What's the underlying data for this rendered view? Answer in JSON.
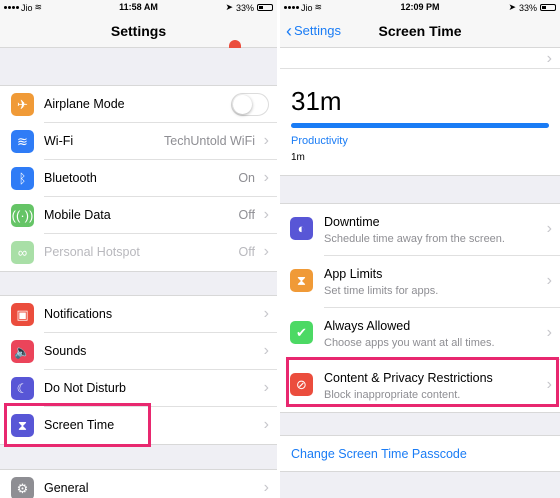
{
  "left": {
    "status": {
      "carrier": "Jio",
      "time": "11:58 AM",
      "battery": "33%"
    },
    "nav_title": "Settings",
    "group1": [
      {
        "label": "Airplane Mode",
        "icon": "airplane-icon",
        "color": "#f09a37",
        "toggle": false
      },
      {
        "label": "Wi-Fi",
        "value": "TechUntold WiFi",
        "icon": "wifi-icon",
        "color": "#2f7cf6"
      },
      {
        "label": "Bluetooth",
        "value": "On",
        "icon": "bluetooth-icon",
        "color": "#2f7cf6"
      },
      {
        "label": "Mobile Data",
        "value": "Off",
        "icon": "antenna-icon",
        "color": "#65c466"
      },
      {
        "label": "Personal Hotspot",
        "value": "Off",
        "icon": "hotspot-icon",
        "color": "#a9dfa7"
      }
    ],
    "group2": [
      {
        "label": "Notifications",
        "icon": "notifications-icon",
        "color": "#eb4d3d"
      },
      {
        "label": "Sounds",
        "icon": "speaker-icon",
        "color": "#eb445a"
      },
      {
        "label": "Do Not Disturb",
        "icon": "moon-icon",
        "color": "#5856d6"
      },
      {
        "label": "Screen Time",
        "icon": "hourglass-icon",
        "color": "#5856d6"
      }
    ],
    "group3": [
      {
        "label": "General",
        "icon": "gear-icon",
        "color": "#8e8e93"
      }
    ]
  },
  "right": {
    "status": {
      "carrier": "Jio",
      "time": "12:09 PM",
      "battery": "33%"
    },
    "back_label": "Settings",
    "nav_title": "Screen Time",
    "total": "31m",
    "category": "Productivity",
    "category_time": "1m",
    "category_fraction": 1.0,
    "bar_color": "#1a7cf5",
    "items": [
      {
        "label": "Downtime",
        "sub": "Schedule time away from the screen.",
        "icon": "downtime-icon",
        "color": "#5856d6"
      },
      {
        "label": "App Limits",
        "sub": "Set time limits for apps.",
        "icon": "hourglass-icon",
        "color": "#f09a37"
      },
      {
        "label": "Always Allowed",
        "sub": "Choose apps you want at all times.",
        "icon": "check-badge-icon",
        "color": "#4cd964"
      },
      {
        "label": "Content & Privacy Restrictions",
        "sub": "Block inappropriate content.",
        "icon": "restriction-icon",
        "color": "#eb4d3d"
      }
    ],
    "passcode_link": "Change Screen Time Passcode"
  },
  "accent": "#1a7cf5",
  "highlight_color": "#e8286f"
}
